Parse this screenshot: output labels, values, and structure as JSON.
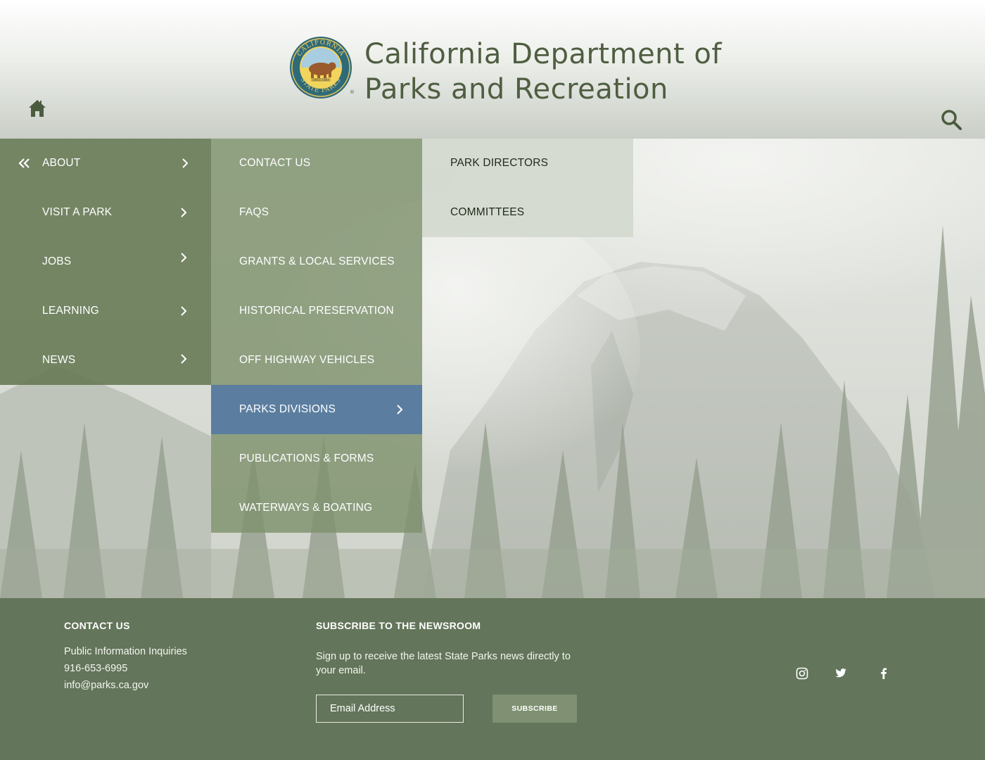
{
  "header": {
    "title_line1": "California Department of",
    "title_line2": "Parks and Recreation",
    "seal": {
      "top_text": "CALIFORNIA",
      "bottom_text": "STATE PARKS",
      "since": "SINCE 1864"
    }
  },
  "menu_level1": [
    {
      "label": "ABOUT"
    },
    {
      "label": "VISIT A PARK"
    },
    {
      "label": "JOBS"
    },
    {
      "label": "LEARNING"
    },
    {
      "label": "NEWS"
    }
  ],
  "menu_level2": [
    {
      "label": "CONTACT US"
    },
    {
      "label": "FAQS"
    },
    {
      "label": "GRANTS & LOCAL SERVICES"
    },
    {
      "label": "HISTORICAL PRESERVATION"
    },
    {
      "label": "OFF HIGHWAY VEHICLES"
    },
    {
      "label": "PARKS DIVISIONS"
    },
    {
      "label": "PUBLICATIONS & FORMS"
    },
    {
      "label": "WATERWAYS & BOATING"
    }
  ],
  "menu_level3": [
    {
      "label": "PARK DIRECTORS"
    },
    {
      "label": "COMMITTEES"
    }
  ],
  "footer": {
    "contact": {
      "title": "CONTACT US",
      "line1": "Public Information Inquiries",
      "phone": "916-653-6995",
      "email": "info@parks.ca.gov"
    },
    "newsroom": {
      "title": "SUBSCRIBE TO THE NEWSROOM",
      "description": "Sign up to receive the latest State Parks news directly to your email.",
      "email_placeholder": "Email Address",
      "subscribe_label": "SUBSCRIBE"
    }
  },
  "icons": {
    "home": "home-icon",
    "search": "search-icon",
    "back": "double-chevron-left-icon",
    "social": [
      "instagram-icon",
      "twitter-icon",
      "facebook-icon"
    ]
  },
  "colors": {
    "header_text": "#4f5e41",
    "menu1_bg": "#647852",
    "menu2_bg": "#7e916c",
    "menu3_bg": "#d4d9d0",
    "active_item": "#5b7ea0",
    "footer_bg": "#63755a",
    "subscribe_bg": "#7f9172"
  }
}
